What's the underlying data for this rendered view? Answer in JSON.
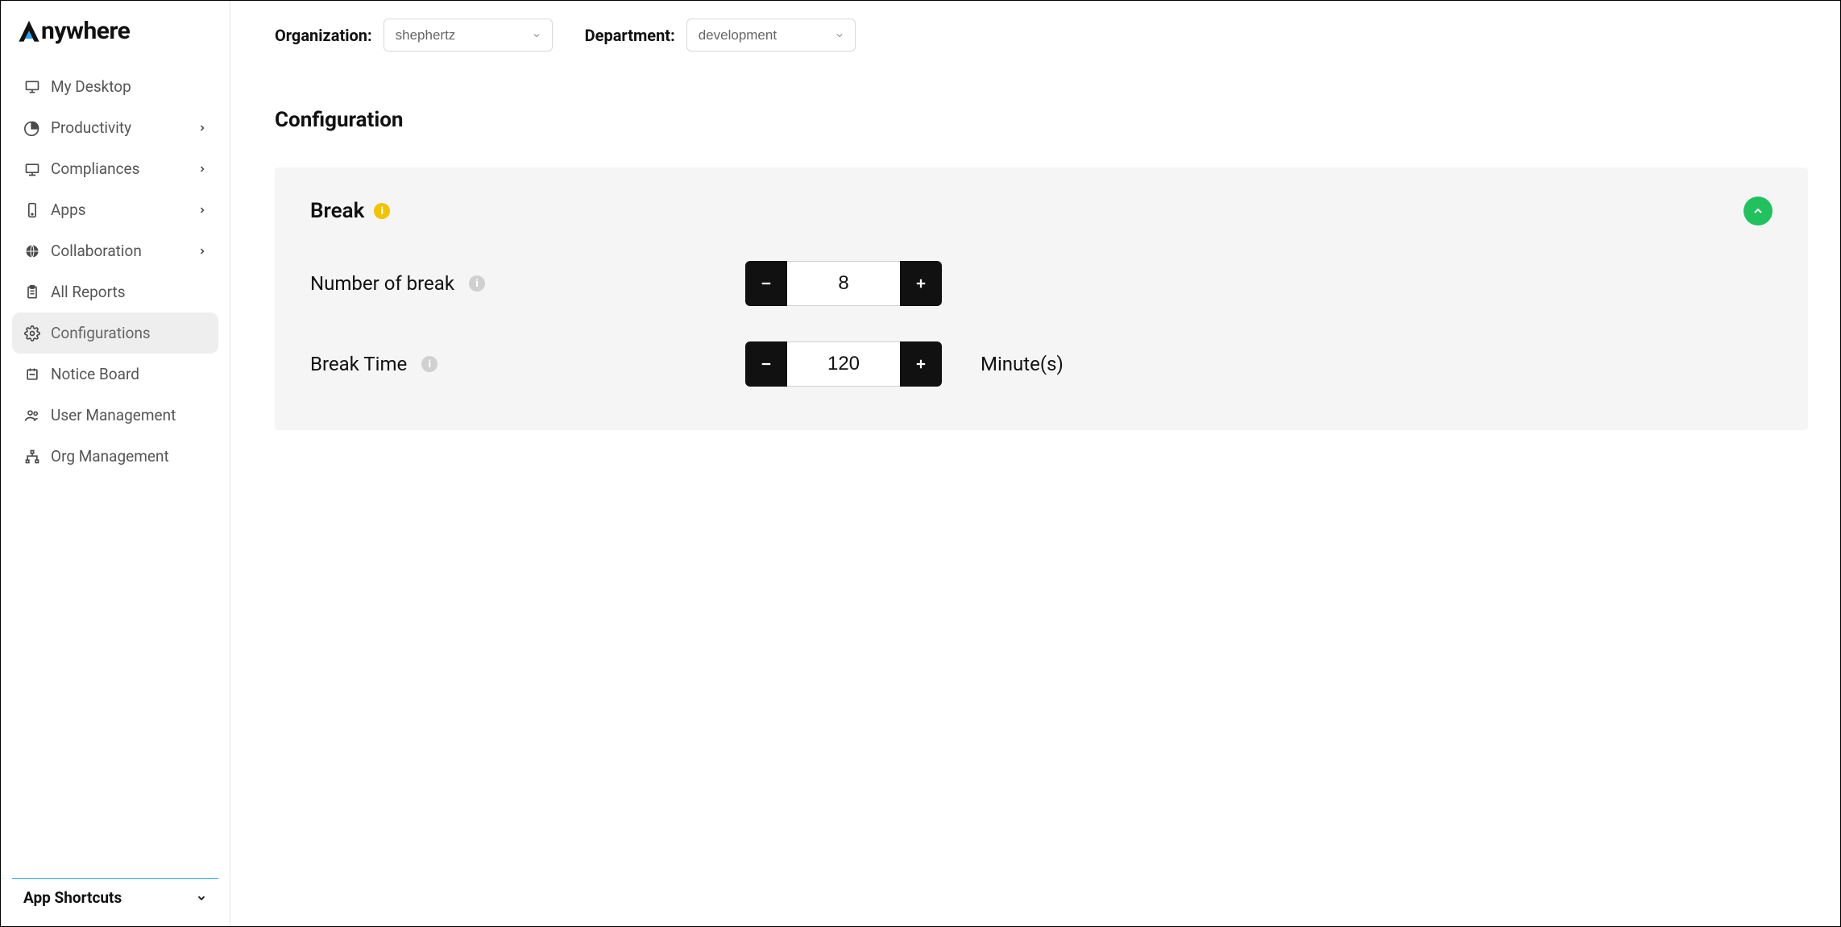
{
  "brand": {
    "name": "nywhere"
  },
  "sidebar": {
    "items": [
      {
        "label": "My Desktop"
      },
      {
        "label": "Productivity"
      },
      {
        "label": "Compliances"
      },
      {
        "label": "Apps"
      },
      {
        "label": "Collaboration"
      },
      {
        "label": "All Reports"
      },
      {
        "label": "Configurations"
      },
      {
        "label": "Notice Board"
      },
      {
        "label": "User Management"
      },
      {
        "label": "Org Management"
      }
    ],
    "shortcuts_label": "App Shortcuts"
  },
  "filters": {
    "org_label": "Organization:",
    "org_value": "shephertz",
    "dept_label": "Department:",
    "dept_value": "development"
  },
  "page": {
    "title": "Configuration"
  },
  "panel": {
    "title": "Break",
    "rows": {
      "num_break": {
        "label": "Number of break",
        "value": "8"
      },
      "break_time": {
        "label": "Break Time",
        "value": "120",
        "unit": "Minute(s)"
      }
    }
  }
}
